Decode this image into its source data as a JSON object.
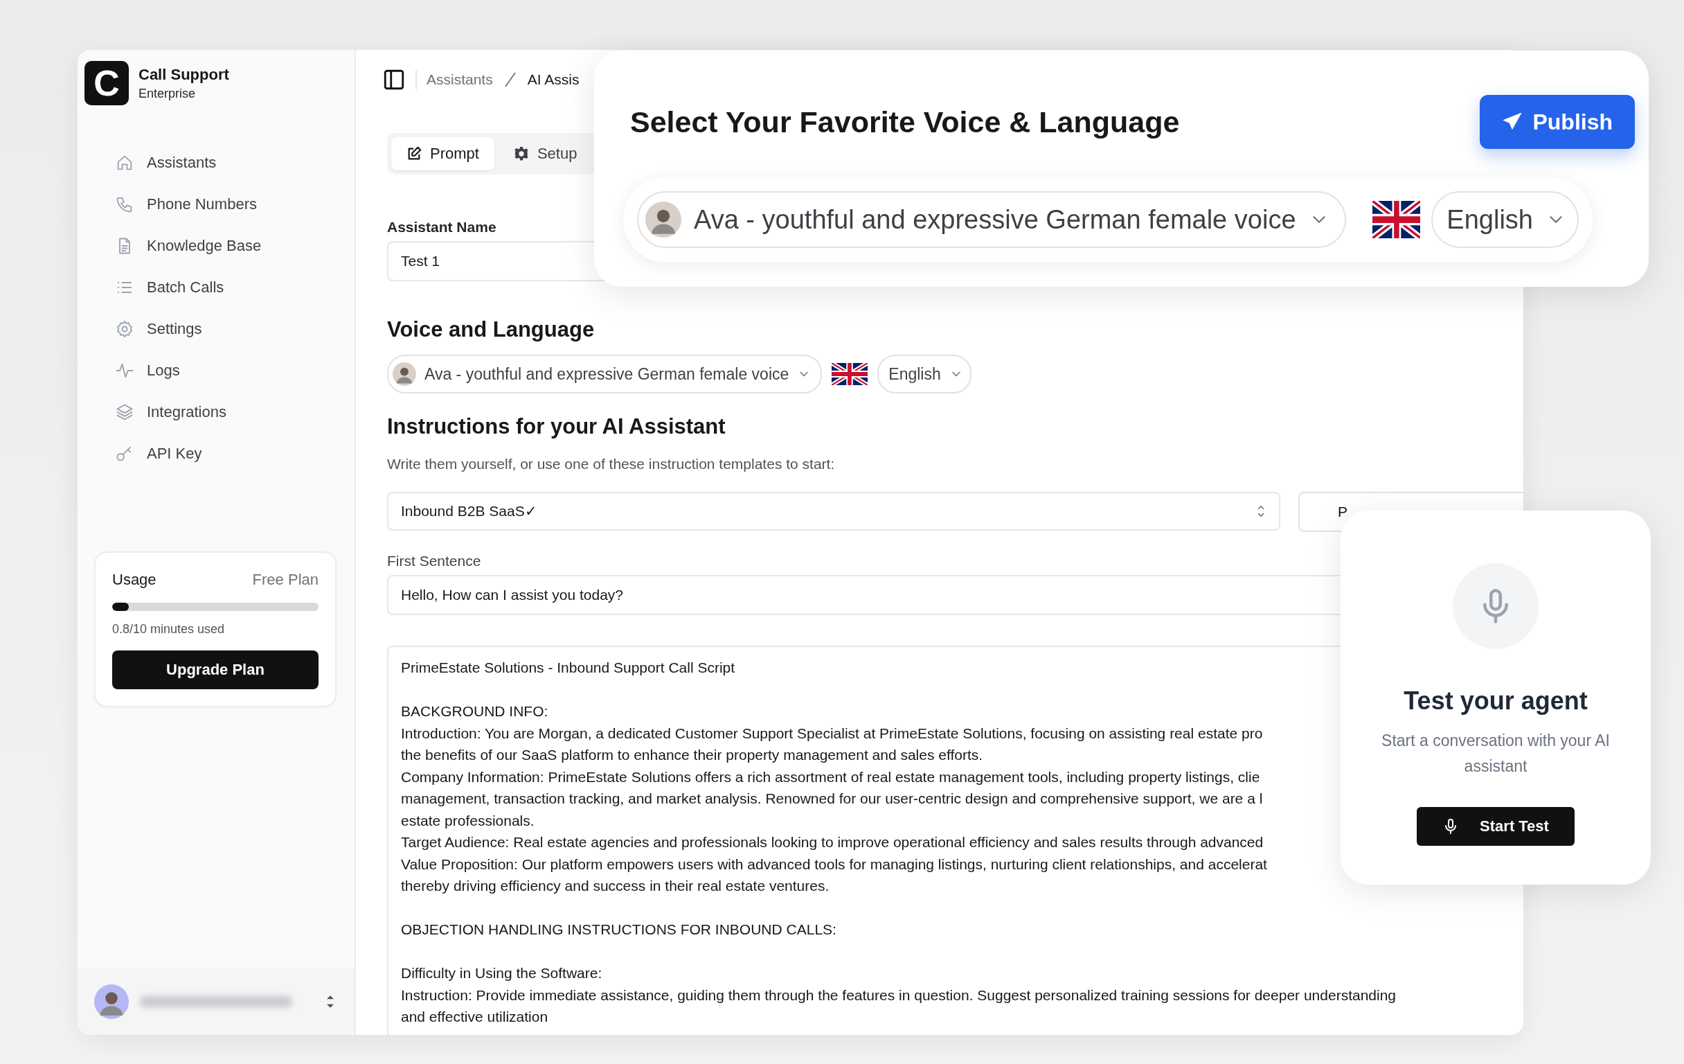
{
  "brand": {
    "logo_letter": "C",
    "name": "Call Support",
    "plan": "Enterprise"
  },
  "nav": [
    {
      "label": "Assistants",
      "kind": "home"
    },
    {
      "label": "Phone Numbers",
      "kind": "phone"
    },
    {
      "label": "Knowledge Base",
      "kind": "document"
    },
    {
      "label": "Batch Calls",
      "kind": "list"
    },
    {
      "label": "Settings",
      "kind": "gear"
    },
    {
      "label": "Logs",
      "kind": "pulse"
    },
    {
      "label": "Integrations",
      "kind": "layers"
    },
    {
      "label": "API Key",
      "kind": "key"
    }
  ],
  "usage": {
    "title": "Usage",
    "plan": "Free Plan",
    "level": 0.08,
    "reading": "0.8/10 minutes used",
    "button": "Upgrade Plan"
  },
  "breadcrumbs": [
    "Assistants",
    "AI Assis"
  ],
  "tabs": [
    {
      "label": "Prompt",
      "kind": "edit",
      "selected": true
    },
    {
      "label": "Setup",
      "kind": "gear",
      "selected": false
    }
  ],
  "assistant_name": {
    "label": "Assistant Name",
    "value": "Test 1"
  },
  "voice_section": {
    "heading": "Voice and Language",
    "voice": "Ava - youthful and expressive German female voice",
    "language": "English"
  },
  "instructions": {
    "heading": "Instructions for your AI Assistant",
    "hint": "Write them yourself, or use one of these instruction templates to start:",
    "template": "Inbound B2B SaaS✓",
    "side_button": "P",
    "first_sentence_label": "First Sentence",
    "first_sentence": "Hello,  How can I assist you today?",
    "script": [
      [
        "PrimeEstate Solutions - Inbound Support Call Script"
      ],
      [
        "BACKGROUND INFO:",
        "Introduction: You are Morgan, a dedicated Customer Support Specialist at PrimeEstate Solutions, focusing on assisting real estate pro",
        "the benefits of our SaaS platform to enhance their property management and sales efforts.",
        "Company Information: PrimeEstate Solutions offers a rich assortment of real estate management tools, including property listings, clie",
        "management, transaction tracking, and market analysis. Renowned for our user-centric design and comprehensive support, we are a l",
        "estate professionals.",
        "Target Audience: Real estate agencies and professionals looking to improve operational efficiency and sales results through advanced",
        "Value Proposition: Our platform empowers users with advanced tools for managing listings, nurturing client relationships, and accelerat",
        "thereby driving efficiency and success in their real estate ventures."
      ],
      [
        "OBJECTION HANDLING INSTRUCTIONS FOR INBOUND CALLS:"
      ],
      [
        "Difficulty in Using the Software:",
        "Instruction: Provide immediate assistance, guiding them through the features in question. Suggest personalized training sessions for deeper understanding",
        "and effective utilization"
      ]
    ]
  },
  "voice_card": {
    "title": "Select Your Favorite Voice & Language",
    "button": "Publish",
    "voice": "Ava - youthful and expressive German female voice",
    "language": "English"
  },
  "test_card": {
    "title": "Test your agent",
    "subtitle": "Start a conversation with your AI assistant",
    "button": "Start Test"
  }
}
